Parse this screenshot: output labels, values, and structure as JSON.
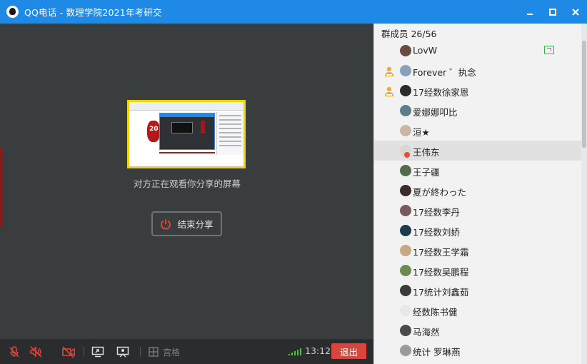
{
  "window": {
    "title": "QQ电话 - 数理学院2021年考研交"
  },
  "stage": {
    "share_caption": "对方正在观看你分享的屏幕",
    "end_share_label": "结束分享",
    "thumbnail_number": "20"
  },
  "toolbar": {
    "grid_label": "宫格",
    "call_time": "13:12",
    "exit_label": "退出"
  },
  "members": {
    "header": "群成员 26/56",
    "items": [
      {
        "name": "LovW",
        "avatar_color": "#6b4a45",
        "badge": "",
        "sharing": true
      },
      {
        "name": "Forever ゛执念",
        "avatar_color": "#8aa0b8",
        "badge": "admin"
      },
      {
        "name": "17经数徐家恩",
        "avatar_color": "#2b2b2b",
        "badge": "admin"
      },
      {
        "name": "爱娜娜叩比",
        "avatar_color": "#5f7d88",
        "badge": ""
      },
      {
        "name": "洹★",
        "avatar_color": "#c9b8a8",
        "badge": ""
      },
      {
        "name": "王伟东",
        "avatar_color": "#d8d8d0",
        "badge": "",
        "muted": true
      },
      {
        "name": "王子疆",
        "avatar_color": "#556b4a",
        "badge": ""
      },
      {
        "name": "夏が終わった",
        "avatar_color": "#3a2a2a",
        "badge": ""
      },
      {
        "name": "17经数李丹",
        "avatar_color": "#7a5a5a",
        "badge": ""
      },
      {
        "name": "17经数刘娇",
        "avatar_color": "#1d3b4a",
        "badge": ""
      },
      {
        "name": "17经数王学霜",
        "avatar_color": "#c8a880",
        "badge": ""
      },
      {
        "name": "17经数吴鹏程",
        "avatar_color": "#6a8a50",
        "badge": ""
      },
      {
        "name": "17统计刘鑫茹",
        "avatar_color": "#3a3a3a",
        "badge": ""
      },
      {
        "name": "经数陈书健",
        "avatar_color": "#e8e8e8",
        "badge": ""
      },
      {
        "name": "马海然",
        "avatar_color": "#4a4a4a",
        "badge": ""
      },
      {
        "name": "统计 罗琳燕",
        "avatar_color": "#9a9a9a",
        "badge": ""
      }
    ]
  },
  "colors": {
    "titlebar": "#1e8ae6",
    "exit": "#d9453c",
    "muted_icon": "#e0463b",
    "highlight_border": "#f2d20a"
  },
  "icons": {
    "app": "qq-penguin-icon",
    "minimize": "minimize-icon",
    "maximize": "maximize-icon",
    "close": "close-icon",
    "mic_off": "mic-off-icon",
    "speaker_off": "speaker-off-icon",
    "camera_off": "camera-off-icon",
    "screen_share": "screen-share-icon",
    "presentation": "presentation-icon",
    "grid": "grid-icon",
    "signal": "signal-icon",
    "power": "power-icon"
  }
}
